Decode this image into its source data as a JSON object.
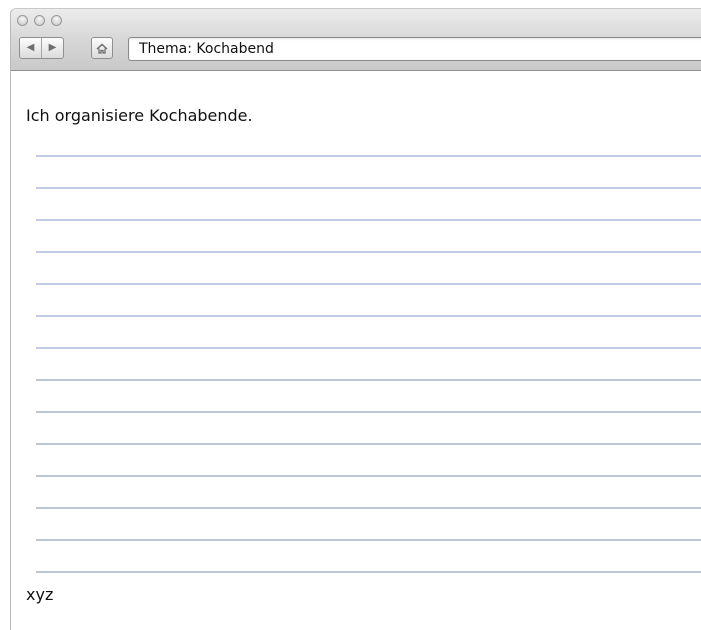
{
  "window": {
    "address": "Thema: Kochabend",
    "nav": {
      "back_glyph": "◀",
      "forward_glyph": "▶"
    },
    "icons": [
      "home-icon",
      "back-icon",
      "forward-icon"
    ]
  },
  "page": {
    "intro": "Ich organisiere Kochabende.",
    "outro": "xyz",
    "line_count": 14,
    "line_colors": [
      "#c3cae6",
      "#bcc7d6"
    ]
  }
}
